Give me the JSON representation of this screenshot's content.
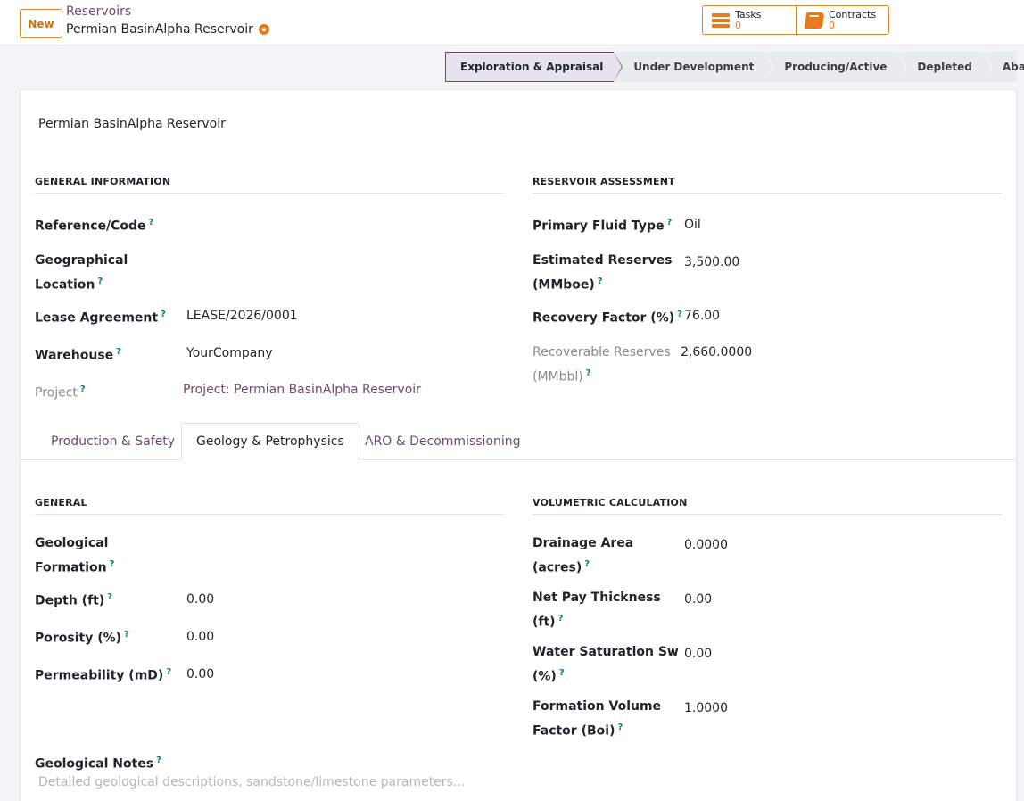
{
  "control_panel": {
    "new_label": "New",
    "breadcrumb_parent": "Reservoirs",
    "breadcrumb_current": "Permian BasinAlpha Reservoir",
    "smart_buttons": [
      {
        "label": "Tasks",
        "value": "0",
        "icon": "tasks-icon"
      },
      {
        "label": "Contracts",
        "value": "0",
        "icon": "book-icon"
      }
    ]
  },
  "statusbar": {
    "stages": [
      "Exploration & Appraisal",
      "Under Development",
      "Producing/Active",
      "Depleted",
      "Abandoned"
    ],
    "active_stage": "Exploration & Appraisal"
  },
  "record": {
    "name": "Permian BasinAlpha Reservoir",
    "help_marker": "?",
    "general_information": {
      "title": "GENERAL INFORMATION",
      "reference_label": "Reference/Code",
      "reference_value": "",
      "geo_location_label_1": "Geographical",
      "geo_location_label_2": "Location",
      "geo_location_value": "",
      "lease_label": "Lease Agreement",
      "lease_value": "LEASE/2026/0001",
      "warehouse_label": "Warehouse",
      "warehouse_value": "YourCompany",
      "project_label": "Project",
      "project_value": "Project: Permian BasinAlpha Reservoir"
    },
    "reservoir_assessment": {
      "title": "RESERVOIR ASSESSMENT",
      "fluid_label": "Primary Fluid Type",
      "fluid_value": "Oil",
      "reserves_label_1": "Estimated Reserves",
      "reserves_label_2": "(MMboe)",
      "reserves_value": "3,500.00",
      "recovery_label": "Recovery Factor (%)",
      "recovery_value": "76.00",
      "recoverable_label_1": "Recoverable Reserves",
      "recoverable_label_2": "(MMbbl)",
      "recoverable_value": "2,660.0000"
    }
  },
  "tabs": [
    "Production & Safety",
    "Geology & Petrophysics",
    "ARO & Decommissioning"
  ],
  "active_tab": "Geology & Petrophysics",
  "geology": {
    "general": {
      "title": "GENERAL",
      "formation_label_1": "Geological",
      "formation_label_2": "Formation",
      "formation_value": "",
      "depth_label": "Depth (ft)",
      "depth_value": "0.00",
      "porosity_label": "Porosity (%)",
      "porosity_value": "0.00",
      "permeability_label": "Permeability (mD)",
      "permeability_value": "0.00"
    },
    "volumetric": {
      "title": "VOLUMETRIC CALCULATION",
      "drainage_label_1": "Drainage Area",
      "drainage_label_2": "(acres)",
      "drainage_value": "0.0000",
      "netpay_label_1": "Net Pay Thickness",
      "netpay_label_2": "(ft)",
      "netpay_value": "0.00",
      "sw_label_1": "Water Saturation Sw",
      "sw_label_2": "(%)",
      "sw_value": "0.00",
      "fvf_label_1": "Formation Volume",
      "fvf_label_2": "Factor (Boi)",
      "fvf_value": "1.0000"
    },
    "notes_label": "Geological Notes",
    "notes_placeholder": "Detailed geological descriptions, sandstone/limestone parameters..."
  }
}
